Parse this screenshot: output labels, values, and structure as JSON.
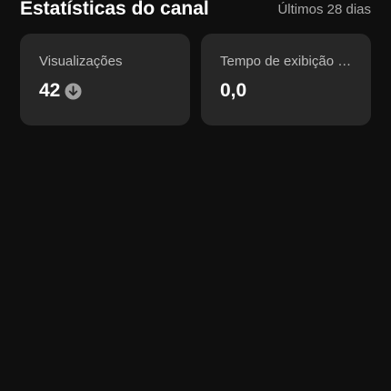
{
  "header": {
    "title": "Estatísticas do canal",
    "period": "Últimos 28 dias"
  },
  "cards": [
    {
      "label": "Visualizações",
      "value": "42",
      "trend_icon": "arrow-down-circle-icon"
    },
    {
      "label": "Tempo de exibição (horas)",
      "value": "0,0"
    }
  ],
  "colors": {
    "background": "#0f0f0f",
    "card_background": "#272727",
    "label_text": "#bdbdbd",
    "trend_icon": "#a0a0a0"
  }
}
